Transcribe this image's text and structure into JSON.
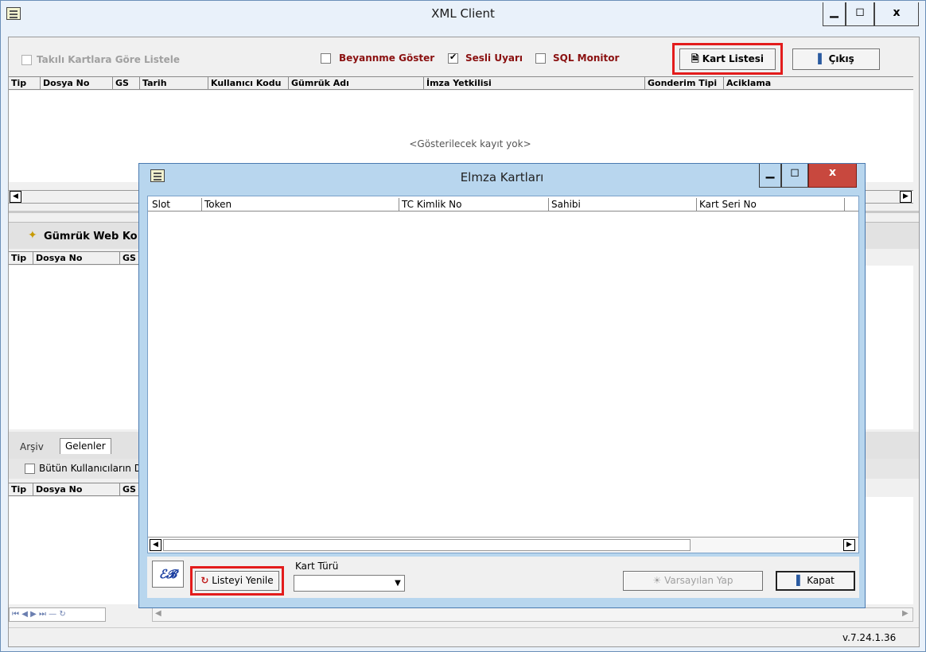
{
  "window": {
    "title": "XML Client"
  },
  "toolbar": {
    "filter_label": "Takılı Kartlara Göre Listele",
    "beyanname_label": "Beyannme Göster",
    "sesli_label": "Sesli Uyarı",
    "sql_label": "SQL Monitor",
    "kart_listesi_label": "Kart Listesi",
    "cikis_label": "Çıkış"
  },
  "main_grid": {
    "columns": [
      "Tip",
      "Dosya No",
      "GS",
      "Tarih",
      "Kullanıcı Kodu",
      "Gümrük Adı",
      "İmza Yetkilisi",
      "Gonderim Tipi",
      "Aciklama"
    ],
    "empty_text": "<Gösterilecek kayıt yok>"
  },
  "web_panel": {
    "title": "Gümrük Web Ko",
    "columns": [
      "Tip",
      "Dosya No",
      "GS"
    ]
  },
  "tabs": {
    "arsiv": "Arşiv",
    "gelenler": "Gelenler"
  },
  "lower_panel": {
    "all_users_label": "Bütün Kullanıcıların D",
    "columns": [
      "Tip",
      "Dosya No",
      "GS"
    ]
  },
  "status": {
    "version": "v.7.24.1.36"
  },
  "dialog": {
    "title": "Elmza Kartları",
    "columns": [
      "Slot",
      "Token",
      "TC Kimlik No",
      "Sahibi",
      "Kart Seri No"
    ],
    "refresh_label": "Listeyi Yenile",
    "card_type_label": "Kart Türü",
    "card_type_value": "",
    "default_label": "Varsayılan Yap",
    "close_label": "Kapat"
  },
  "colors": {
    "highlight": "#e31c1c",
    "dialog_frame": "#b8d6ee",
    "label_red": "#8a1010"
  }
}
